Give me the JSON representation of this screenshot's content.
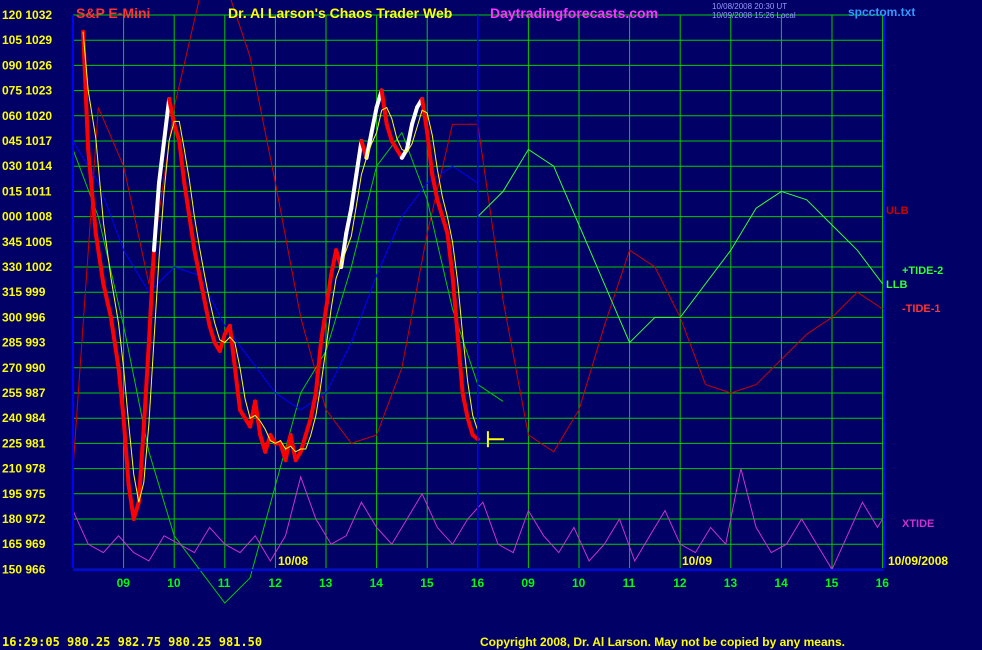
{
  "header": {
    "symbol": "S&P E-Mini",
    "title": "Dr. Al Larson's Chaos Trader Web",
    "site": "Daytradingforecasts.com",
    "stamp_1": "10/08/2008 20:30 UT",
    "stamp_2": "10/09/2008 15:26 Local",
    "file": "spcctom.txt"
  },
  "footer": {
    "quote": "16:29:05  980.25 982.75 980.25 981.50",
    "copyright": "Copyright 2008, Dr. Al Larson. May not be copied by any means."
  },
  "colors": {
    "background": "#000066",
    "grid": "#00CC00",
    "price_down": "#FF0000",
    "price_up": "#FFFFFF",
    "average": "#FFFF00",
    "ulb": "#CC0000",
    "llb": "#00CC00",
    "tide2": "#33FF33",
    "tide1": "#FF3333",
    "blue_band": "#0000FF",
    "xtide": "#CC33CC",
    "axis_text": "#FFFF00",
    "hour_text": "#00FF00"
  },
  "chart_data": {
    "type": "line",
    "y_left_labels": [
      "120 1032",
      "105 1029",
      "090 1026",
      "075 1023",
      "060 1020",
      "045 1017",
      "030 1014",
      "015 1011",
      "000 1008",
      "345 1005",
      "330 1002",
      "315 999",
      "300 996",
      "285 993",
      "270 990",
      "255 987",
      "240 984",
      "225 981",
      "210 978",
      "195 975",
      "180 972",
      "165 969",
      "150 966"
    ],
    "ylim": [
      966,
      1032
    ],
    "y_step": 3,
    "x_hours": [
      "09",
      "10",
      "11",
      "12",
      "13",
      "14",
      "15",
      "16",
      "09",
      "10",
      "11",
      "12",
      "13",
      "14",
      "15",
      "16"
    ],
    "date_labels": [
      "10/08",
      "10/09"
    ],
    "end_date": "10/09/2008",
    "series_labels": {
      "ulb": "ULB",
      "tide2": "+TIDE-2",
      "llb": "LLB",
      "tide1": "-TIDE-1",
      "xtide": "XTIDE"
    },
    "last_price": 981.5,
    "price": [
      [
        8.2,
        1030
      ],
      [
        8.3,
        1016
      ],
      [
        8.45,
        1006
      ],
      [
        8.6,
        1000
      ],
      [
        8.75,
        996
      ],
      [
        8.9,
        990
      ],
      [
        9.0,
        984
      ],
      [
        9.1,
        976
      ],
      [
        9.2,
        972
      ],
      [
        9.3,
        974
      ],
      [
        9.4,
        983
      ],
      [
        9.5,
        993
      ],
      [
        9.6,
        1004
      ],
      [
        9.7,
        1012
      ],
      [
        9.8,
        1017
      ],
      [
        9.9,
        1022
      ],
      [
        10.0,
        1019
      ],
      [
        10.1,
        1017
      ],
      [
        10.2,
        1012
      ],
      [
        10.3,
        1008
      ],
      [
        10.4,
        1004
      ],
      [
        10.5,
        1001
      ],
      [
        10.6,
        998
      ],
      [
        10.7,
        995
      ],
      [
        10.8,
        993
      ],
      [
        10.9,
        992
      ],
      [
        11.0,
        994
      ],
      [
        11.1,
        995
      ],
      [
        11.2,
        990
      ],
      [
        11.3,
        985
      ],
      [
        11.4,
        984
      ],
      [
        11.5,
        983
      ],
      [
        11.6,
        986
      ],
      [
        11.7,
        982
      ],
      [
        11.8,
        980
      ],
      [
        11.9,
        982
      ],
      [
        12.0,
        981
      ],
      [
        12.1,
        981
      ],
      [
        12.2,
        979
      ],
      [
        12.3,
        982
      ],
      [
        12.4,
        979
      ],
      [
        12.5,
        980
      ],
      [
        12.6,
        982
      ],
      [
        12.7,
        984
      ],
      [
        12.8,
        987
      ],
      [
        12.9,
        993
      ],
      [
        13.0,
        997
      ],
      [
        13.1,
        1001
      ],
      [
        13.2,
        1004
      ],
      [
        13.3,
        1002
      ],
      [
        13.4,
        1006
      ],
      [
        13.5,
        1009
      ],
      [
        13.6,
        1013
      ],
      [
        13.7,
        1017
      ],
      [
        13.8,
        1015
      ],
      [
        13.9,
        1018
      ],
      [
        14.0,
        1021
      ],
      [
        14.1,
        1023
      ],
      [
        14.2,
        1019
      ],
      [
        14.3,
        1017
      ],
      [
        14.4,
        1016
      ],
      [
        14.5,
        1015
      ],
      [
        14.6,
        1016
      ],
      [
        14.7,
        1019
      ],
      [
        14.8,
        1021
      ],
      [
        14.9,
        1022
      ],
      [
        15.0,
        1018
      ],
      [
        15.1,
        1013
      ],
      [
        15.2,
        1010
      ],
      [
        15.3,
        1008
      ],
      [
        15.4,
        1006
      ],
      [
        15.5,
        1001
      ],
      [
        15.6,
        994
      ],
      [
        15.7,
        987
      ],
      [
        15.8,
        984
      ],
      [
        15.9,
        982
      ],
      [
        16.0,
        981.5
      ]
    ],
    "series": [
      {
        "key": "ulb",
        "points": [
          [
            8.0,
            978
          ],
          [
            8.5,
            1021
          ],
          [
            9.0,
            1014
          ],
          [
            9.5,
            1000
          ],
          [
            10.0,
            1021
          ],
          [
            10.5,
            1034
          ],
          [
            11.0,
            1036
          ],
          [
            11.5,
            1027
          ],
          [
            12.0,
            1012
          ],
          [
            12.5,
            996
          ],
          [
            13.0,
            985
          ],
          [
            13.5,
            981
          ],
          [
            14.0,
            982
          ],
          [
            14.5,
            990
          ],
          [
            15.0,
            1006
          ],
          [
            15.5,
            1019
          ],
          [
            16.0,
            1019
          ],
          [
            16.5,
            998
          ],
          [
            17.0,
            982
          ],
          [
            17.5,
            980
          ],
          [
            18.0,
            985
          ],
          [
            18.5,
            995
          ],
          [
            19.0,
            1004
          ],
          [
            19.5,
            1002
          ],
          [
            20.0,
            996
          ],
          [
            20.5,
            988
          ],
          [
            21.0,
            987
          ],
          [
            21.5,
            988
          ],
          [
            22.0,
            991
          ],
          [
            22.5,
            994
          ],
          [
            23.0,
            996
          ],
          [
            23.5,
            999
          ],
          [
            24.0,
            997
          ]
        ]
      },
      {
        "key": "llb",
        "points": [
          [
            8.0,
            1016
          ],
          [
            8.5,
            1008
          ],
          [
            9.0,
            995
          ],
          [
            9.5,
            980
          ],
          [
            10.0,
            970
          ],
          [
            10.5,
            966
          ],
          [
            11.0,
            962
          ],
          [
            11.5,
            965
          ],
          [
            12.0,
            976
          ],
          [
            12.5,
            987
          ],
          [
            13.0,
            992
          ],
          [
            13.5,
            1002
          ],
          [
            14.0,
            1014
          ],
          [
            14.5,
            1018
          ],
          [
            15.0,
            1010
          ],
          [
            15.5,
            997
          ],
          [
            16.0,
            988
          ],
          [
            16.5,
            986
          ]
        ]
      },
      {
        "key": "tide2",
        "points": [
          [
            16.0,
            1008
          ],
          [
            16.5,
            1011
          ],
          [
            17.0,
            1016
          ],
          [
            17.5,
            1014
          ],
          [
            18.0,
            1007
          ],
          [
            18.5,
            1000
          ],
          [
            19.0,
            993
          ],
          [
            19.5,
            996
          ],
          [
            20.0,
            996
          ],
          [
            20.5,
            1000
          ],
          [
            21.0,
            1004
          ],
          [
            21.5,
            1009
          ],
          [
            22.0,
            1011
          ],
          [
            22.5,
            1010
          ],
          [
            23.0,
            1007
          ],
          [
            23.5,
            1004
          ],
          [
            24.0,
            1000
          ]
        ]
      },
      {
        "key": "blue",
        "points": [
          [
            8.0,
            1017
          ],
          [
            8.5,
            1012
          ],
          [
            9.0,
            1004
          ],
          [
            9.5,
            999
          ],
          [
            10.0,
            1002
          ],
          [
            10.5,
            1001
          ],
          [
            11.0,
            995
          ],
          [
            11.5,
            991
          ],
          [
            12.0,
            987
          ],
          [
            12.5,
            985
          ],
          [
            13.0,
            987
          ],
          [
            13.5,
            993
          ],
          [
            14.0,
            1001
          ],
          [
            14.5,
            1008
          ],
          [
            15.0,
            1012
          ],
          [
            15.5,
            1014
          ],
          [
            16.0,
            1012
          ]
        ]
      },
      {
        "key": "xtide",
        "points": [
          [
            8.0,
            973
          ],
          [
            8.3,
            969
          ],
          [
            8.6,
            968
          ],
          [
            8.9,
            970
          ],
          [
            9.2,
            968
          ],
          [
            9.5,
            967
          ],
          [
            9.8,
            970
          ],
          [
            10.1,
            969
          ],
          [
            10.4,
            968
          ],
          [
            10.7,
            971
          ],
          [
            11.0,
            969
          ],
          [
            11.3,
            968
          ],
          [
            11.6,
            970
          ],
          [
            11.9,
            967
          ],
          [
            12.2,
            970
          ],
          [
            12.5,
            977
          ],
          [
            12.8,
            972
          ],
          [
            13.1,
            969
          ],
          [
            13.4,
            970
          ],
          [
            13.7,
            974
          ],
          [
            14.0,
            971
          ],
          [
            14.3,
            969
          ],
          [
            14.6,
            972
          ],
          [
            14.9,
            975
          ],
          [
            15.2,
            971
          ],
          [
            15.5,
            969
          ],
          [
            15.8,
            972
          ],
          [
            16.1,
            974
          ],
          [
            16.4,
            969
          ],
          [
            16.7,
            968
          ],
          [
            17.0,
            973
          ],
          [
            17.3,
            970
          ],
          [
            17.6,
            968
          ],
          [
            17.9,
            971
          ],
          [
            18.2,
            967
          ],
          [
            18.5,
            969
          ],
          [
            18.8,
            972
          ],
          [
            19.1,
            967
          ],
          [
            19.4,
            970
          ],
          [
            19.7,
            973
          ],
          [
            20.0,
            969
          ],
          [
            20.3,
            968
          ],
          [
            20.6,
            971
          ],
          [
            20.9,
            969
          ],
          [
            21.2,
            978
          ],
          [
            21.5,
            971
          ],
          [
            21.8,
            968
          ],
          [
            22.1,
            969
          ],
          [
            22.4,
            972
          ],
          [
            22.7,
            969
          ],
          [
            23.0,
            966
          ],
          [
            23.3,
            970
          ],
          [
            23.6,
            974
          ],
          [
            23.9,
            971
          ],
          [
            24.0,
            972
          ]
        ]
      }
    ]
  }
}
